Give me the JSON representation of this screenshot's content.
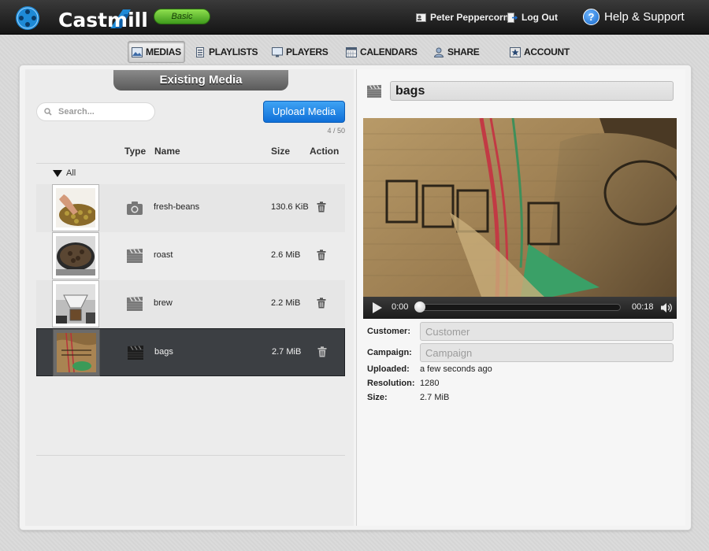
{
  "header": {
    "app_name": "Castmill",
    "plan_badge": "Basic",
    "user_name": "Peter Peppercorn",
    "logout_label": "Log Out",
    "help_label": "Help & Support",
    "help_glyph": "?"
  },
  "nav": {
    "items": [
      {
        "label": "MEDIAS",
        "icon": "medias-icon",
        "active": true
      },
      {
        "label": "PLAYLISTS",
        "icon": "playlists-icon"
      },
      {
        "label": "PLAYERS",
        "icon": "players-icon"
      },
      {
        "label": "CALENDARS",
        "icon": "calendars-icon"
      },
      {
        "label": "SHARE",
        "icon": "share-icon"
      },
      {
        "label": "ACCOUNT",
        "icon": "account-icon"
      }
    ]
  },
  "media_list": {
    "section_title": "Existing Media",
    "search_placeholder": "Search...",
    "upload_label": "Upload Media",
    "count_text": "4 / 50",
    "columns": {
      "type": "Type",
      "name": "Name",
      "size": "Size",
      "action": "Action"
    },
    "group_label": "All",
    "items": [
      {
        "name": "fresh-beans",
        "size": "130.6 KiB",
        "type_icon": "camera-icon",
        "action_icon": "trash-icon"
      },
      {
        "name": "roast",
        "size": "2.6 MiB",
        "type_icon": "clapperboard-icon",
        "action_icon": "trash-icon"
      },
      {
        "name": "brew",
        "size": "2.2 MiB",
        "type_icon": "clapperboard-icon",
        "action_icon": "trash-icon"
      },
      {
        "name": "bags",
        "size": "2.7 MiB",
        "type_icon": "clapperboard-icon",
        "action_icon": "trash-icon",
        "selected": true
      }
    ]
  },
  "details": {
    "title": "bags",
    "type_icon": "clapperboard-icon",
    "player": {
      "current_time": "0:00",
      "duration": "00:18",
      "progress": 0.0
    },
    "fields": {
      "customer_label": "Customer:",
      "customer_placeholder": "Customer",
      "campaign_label": "Campaign:",
      "campaign_placeholder": "Campaign",
      "uploaded_label": "Uploaded:",
      "uploaded_value": "a few seconds ago",
      "resolution_label": "Resolution:",
      "resolution_value": "1280",
      "size_label": "Size:",
      "size_value": "2.7 MiB"
    }
  },
  "colors": {
    "topbar": "#1f1f1f",
    "plan_badge": "#5cc02f",
    "upload_button": "#1b82e6",
    "selected_row": "#3c3f43"
  }
}
